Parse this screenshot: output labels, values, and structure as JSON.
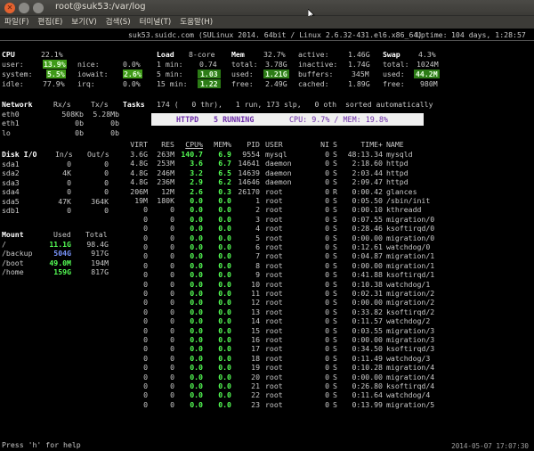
{
  "window": {
    "title": "root@suk53:/var/log",
    "menu": [
      "파일(F)",
      "편집(E)",
      "보기(V)",
      "검색(S)",
      "터미널(T)",
      "도움말(H)"
    ]
  },
  "top": {
    "host": "suk53.suidc.com (SULinux 2014. 64bit / Linux 2.6.32-431.el6.x86_64)",
    "uptime_label": "Uptime:",
    "uptime": "104 days, 1:28:57"
  },
  "cpu": {
    "title": "CPU",
    "total": "22.1%",
    "user_l": "user:",
    "user": "13.9%",
    "system_l": "system:",
    "system": "5.5%",
    "idle_l": "idle:",
    "idle": "77.9%",
    "nice_l": "nice:",
    "nice": "0.0%",
    "iowait_l": "iowait:",
    "iowait": "2.6%",
    "irq_l": "irq:",
    "irq": "0.0%"
  },
  "load": {
    "title": "Load",
    "cores": "8-core",
    "m1_l": "1 min:",
    "m1": "0.74",
    "m5_l": "5 min:",
    "m5": "1.03",
    "m15_l": "15 min:",
    "m15": "1.22"
  },
  "mem": {
    "title": "Mem",
    "pct": "32.7%",
    "total_l": "total:",
    "total": "3.78G",
    "used_l": "used:",
    "used": "1.21G",
    "free_l": "free:",
    "free": "2.49G",
    "active_l": "active:",
    "active": "1.46G",
    "inactive_l": "inactive:",
    "inactive": "1.74G",
    "buffers_l": "buffers:",
    "buffers": "345M",
    "cached_l": "cached:",
    "cached": "1.89G"
  },
  "swap": {
    "title": "Swap",
    "pct": "4.3%",
    "total_l": "total:",
    "total": "1024M",
    "used_l": "used:",
    "used": "44.2M",
    "free_l": "free:",
    "free": "980M"
  },
  "network": {
    "title": "Network",
    "rx": "Rx/s",
    "tx": "Tx/s",
    "rows": [
      {
        "name": "eth0",
        "rx": "508Kb",
        "tx": "5.28Mb"
      },
      {
        "name": "eth1",
        "rx": "0b",
        "tx": "0b"
      },
      {
        "name": "lo",
        "rx": "0b",
        "tx": "0b"
      }
    ]
  },
  "tasks": {
    "title": "Tasks",
    "line": "174 (   0 thr),   1 run, 173 slp,   0 oth  sorted automatically"
  },
  "banner": {
    "name": "HTTPD",
    "running": "5 RUNNING",
    "stats": "CPU: 9.7% / MEM: 19.8%"
  },
  "disk": {
    "title": "Disk I/O",
    "in": "In/s",
    "out": "Out/s",
    "rows": [
      {
        "name": "sda1",
        "in": "0",
        "out": "0"
      },
      {
        "name": "sda2",
        "in": "4K",
        "out": "0"
      },
      {
        "name": "sda3",
        "in": "0",
        "out": "0"
      },
      {
        "name": "sda4",
        "in": "0",
        "out": "0"
      },
      {
        "name": "sda5",
        "in": "47K",
        "out": "364K"
      },
      {
        "name": "sdb1",
        "in": "0",
        "out": "0"
      }
    ]
  },
  "mount": {
    "title": "Mount",
    "used": "Used",
    "total": "Total",
    "rows": [
      {
        "name": "/",
        "used": "11.1G",
        "total": "98.4G",
        "cls": "grn"
      },
      {
        "name": "/backup",
        "used": "504G",
        "total": "917G",
        "cls": "blu"
      },
      {
        "name": "/boot",
        "used": "49.0M",
        "total": "194M",
        "cls": "grn"
      },
      {
        "name": "/home",
        "used": "159G",
        "total": "817G",
        "cls": "grn"
      }
    ]
  },
  "procs": {
    "headers": [
      "VIRT",
      "RES",
      "CPU%",
      "MEM%",
      "PID",
      "USER",
      "NI",
      "S",
      "TIME+",
      "NAME"
    ],
    "rows": [
      [
        "3.6G",
        "263M",
        "140.7",
        "6.9",
        "9554",
        "mysql",
        "0",
        "S",
        "48:13.34",
        "mysqld"
      ],
      [
        "4.8G",
        "253M",
        "3.6",
        "6.7",
        "14641",
        "daemon",
        "0",
        "S",
        "2:18.60",
        "httpd"
      ],
      [
        "4.8G",
        "246M",
        "3.2",
        "6.5",
        "14639",
        "daemon",
        "0",
        "S",
        "2:03.44",
        "httpd"
      ],
      [
        "4.8G",
        "236M",
        "2.9",
        "6.2",
        "14646",
        "daemon",
        "0",
        "S",
        "2:09.47",
        "httpd"
      ],
      [
        "206M",
        "12M",
        "2.6",
        "0.3",
        "26170",
        "root",
        "0",
        "R",
        "0:00.42",
        "glances"
      ],
      [
        "19M",
        "180K",
        "0.0",
        "0.0",
        "1",
        "root",
        "0",
        "S",
        "0:05.50",
        "/sbin/init"
      ],
      [
        "0",
        "0",
        "0.0",
        "0.0",
        "2",
        "root",
        "0",
        "S",
        "0:00.10",
        "kthreadd"
      ],
      [
        "0",
        "0",
        "0.0",
        "0.0",
        "3",
        "root",
        "0",
        "S",
        "0:07.55",
        "migration/0"
      ],
      [
        "0",
        "0",
        "0.0",
        "0.0",
        "4",
        "root",
        "0",
        "S",
        "0:28.46",
        "ksoftirqd/0"
      ],
      [
        "0",
        "0",
        "0.0",
        "0.0",
        "5",
        "root",
        "0",
        "S",
        "0:00.00",
        "migration/0"
      ],
      [
        "0",
        "0",
        "0.0",
        "0.0",
        "6",
        "root",
        "0",
        "S",
        "0:12.61",
        "watchdog/0"
      ],
      [
        "0",
        "0",
        "0.0",
        "0.0",
        "7",
        "root",
        "0",
        "S",
        "0:04.87",
        "migration/1"
      ],
      [
        "0",
        "0",
        "0.0",
        "0.0",
        "8",
        "root",
        "0",
        "S",
        "0:00.00",
        "migration/1"
      ],
      [
        "0",
        "0",
        "0.0",
        "0.0",
        "9",
        "root",
        "0",
        "S",
        "0:41.88",
        "ksoftirqd/1"
      ],
      [
        "0",
        "0",
        "0.0",
        "0.0",
        "10",
        "root",
        "0",
        "S",
        "0:10.38",
        "watchdog/1"
      ],
      [
        "0",
        "0",
        "0.0",
        "0.0",
        "11",
        "root",
        "0",
        "S",
        "0:02.31",
        "migration/2"
      ],
      [
        "0",
        "0",
        "0.0",
        "0.0",
        "12",
        "root",
        "0",
        "S",
        "0:00.00",
        "migration/2"
      ],
      [
        "0",
        "0",
        "0.0",
        "0.0",
        "13",
        "root",
        "0",
        "S",
        "0:33.82",
        "ksoftirqd/2"
      ],
      [
        "0",
        "0",
        "0.0",
        "0.0",
        "14",
        "root",
        "0",
        "S",
        "0:11.57",
        "watchdog/2"
      ],
      [
        "0",
        "0",
        "0.0",
        "0.0",
        "15",
        "root",
        "0",
        "S",
        "0:03.55",
        "migration/3"
      ],
      [
        "0",
        "0",
        "0.0",
        "0.0",
        "16",
        "root",
        "0",
        "S",
        "0:00.00",
        "migration/3"
      ],
      [
        "0",
        "0",
        "0.0",
        "0.0",
        "17",
        "root",
        "0",
        "S",
        "0:34.50",
        "ksoftirqd/3"
      ],
      [
        "0",
        "0",
        "0.0",
        "0.0",
        "18",
        "root",
        "0",
        "S",
        "0:11.49",
        "watchdog/3"
      ],
      [
        "0",
        "0",
        "0.0",
        "0.0",
        "19",
        "root",
        "0",
        "S",
        "0:10.28",
        "migration/4"
      ],
      [
        "0",
        "0",
        "0.0",
        "0.0",
        "20",
        "root",
        "0",
        "S",
        "0:00.00",
        "migration/4"
      ],
      [
        "0",
        "0",
        "0.0",
        "0.0",
        "21",
        "root",
        "0",
        "S",
        "0:26.80",
        "ksoftirqd/4"
      ],
      [
        "0",
        "0",
        "0.0",
        "0.0",
        "22",
        "root",
        "0",
        "S",
        "0:11.64",
        "watchdog/4"
      ],
      [
        "0",
        "0",
        "0.0",
        "0.0",
        "23",
        "root",
        "0",
        "S",
        "0:13.99",
        "migration/5"
      ]
    ]
  },
  "footer": {
    "help": "Press 'h' for help",
    "datetime": "2014-05-07 17:07:30"
  }
}
